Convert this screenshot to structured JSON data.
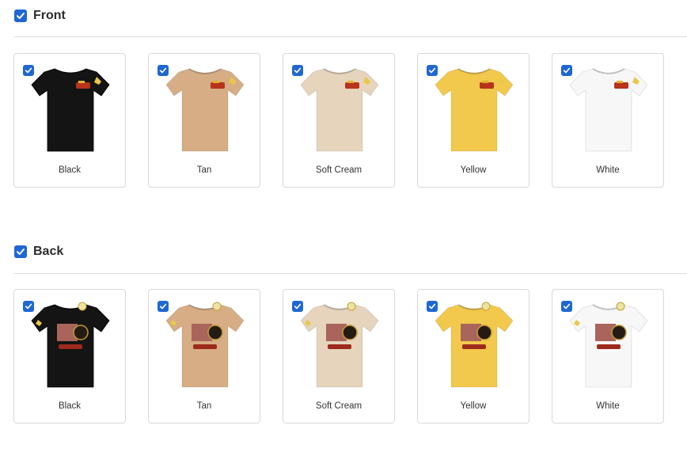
{
  "front": {
    "title": "Front",
    "variants": [
      {
        "label": "Black",
        "color": "#141414"
      },
      {
        "label": "Tan",
        "color": "#d6ad84"
      },
      {
        "label": "Soft Cream",
        "color": "#e6d4bd"
      },
      {
        "label": "Yellow",
        "color": "#f2c94c"
      },
      {
        "label": "White",
        "color": "#f7f7f7"
      }
    ]
  },
  "back": {
    "title": "Back",
    "variants": [
      {
        "label": "Black",
        "color": "#141414"
      },
      {
        "label": "Tan",
        "color": "#d6ad84"
      },
      {
        "label": "Soft Cream",
        "color": "#e6d4bd"
      },
      {
        "label": "Yellow",
        "color": "#f2c94c"
      },
      {
        "label": "White",
        "color": "#f7f7f7"
      }
    ]
  },
  "colors": {
    "accent": "#1f67d3"
  }
}
